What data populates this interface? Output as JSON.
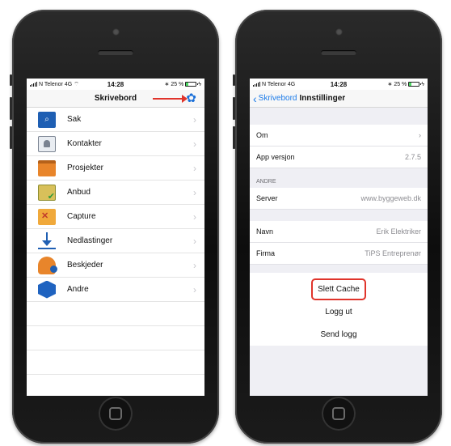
{
  "status_bar": {
    "carrier": "N Telenor",
    "network": "4G",
    "time": "14:28",
    "battery_label": "25 %",
    "battery_level": 0.25
  },
  "left_phone": {
    "nav_title": "Skrivebord",
    "gear_icon": "gear-icon",
    "menu": [
      {
        "label": "Sak",
        "icon": "search-icon"
      },
      {
        "label": "Kontakter",
        "icon": "contacts-icon"
      },
      {
        "label": "Prosjekter",
        "icon": "folder-icon"
      },
      {
        "label": "Anbud",
        "icon": "tender-icon"
      },
      {
        "label": "Capture",
        "icon": "capture-icon"
      },
      {
        "label": "Nedlastinger",
        "icon": "download-icon"
      },
      {
        "label": "Beskjeder",
        "icon": "bell-icon"
      },
      {
        "label": "Andre",
        "icon": "cube-icon"
      }
    ]
  },
  "right_phone": {
    "back_label": "Skrivebord",
    "nav_title": "Innstillinger",
    "rows": {
      "om": "Om",
      "app_version_label": "App versjon",
      "app_version_value": "2.7.5",
      "section_andre": "ANDRE",
      "server_label": "Server",
      "server_value": "www.byggeweb.dk",
      "navn_label": "Navn",
      "navn_value": "Erik Elektriker",
      "firma_label": "Firma",
      "firma_value": "TiPS Entreprenør"
    },
    "actions": {
      "slett_cache": "Slett Cache",
      "logg_ut": "Logg ut",
      "send_logg": "Send logg"
    }
  },
  "colors": {
    "accent_blue": "#1a7ae8",
    "highlight_red": "#e0342b"
  }
}
